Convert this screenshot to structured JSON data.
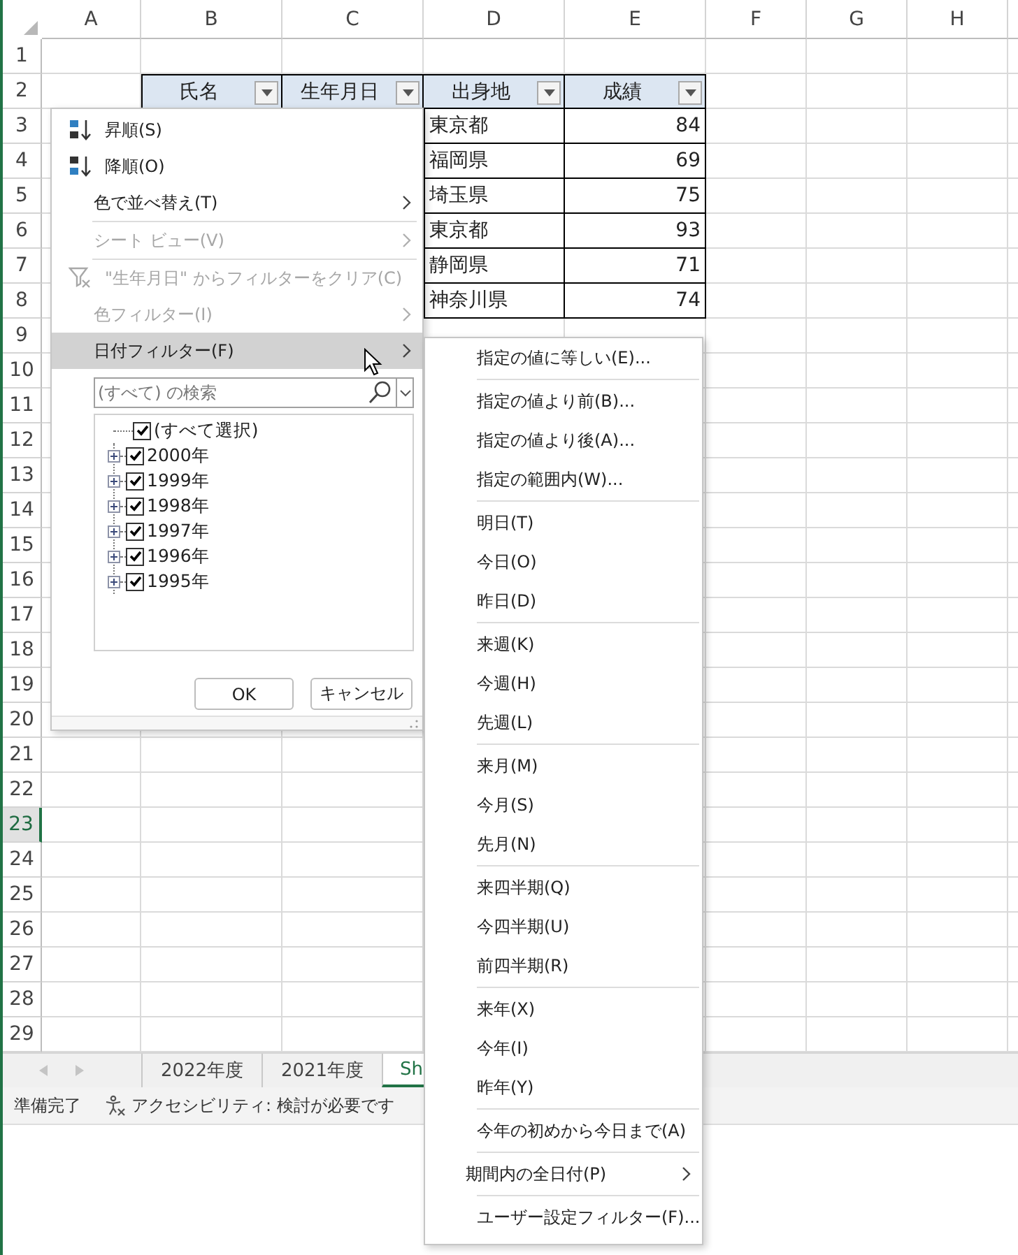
{
  "column_headers": [
    "A",
    "B",
    "C",
    "D",
    "E",
    "F",
    "G",
    "H"
  ],
  "row_headers": [
    {
      "label": "1",
      "selected": false
    },
    {
      "label": "2",
      "selected": false
    },
    {
      "label": "3",
      "selected": false
    },
    {
      "label": "4",
      "selected": false
    },
    {
      "label": "5",
      "selected": false
    },
    {
      "label": "6",
      "selected": false
    },
    {
      "label": "7",
      "selected": false
    },
    {
      "label": "8",
      "selected": false
    },
    {
      "label": "9",
      "selected": false
    },
    {
      "label": "10",
      "selected": false
    },
    {
      "label": "11",
      "selected": false
    },
    {
      "label": "12",
      "selected": false
    },
    {
      "label": "13",
      "selected": false
    },
    {
      "label": "14",
      "selected": false
    },
    {
      "label": "15",
      "selected": false
    },
    {
      "label": "16",
      "selected": false
    },
    {
      "label": "17",
      "selected": false
    },
    {
      "label": "18",
      "selected": false
    },
    {
      "label": "19",
      "selected": false
    },
    {
      "label": "20",
      "selected": false
    },
    {
      "label": "21",
      "selected": false
    },
    {
      "label": "22",
      "selected": false
    },
    {
      "label": "23",
      "selected": true
    },
    {
      "label": "24",
      "selected": false
    },
    {
      "label": "25",
      "selected": false
    },
    {
      "label": "26",
      "selected": false
    },
    {
      "label": "27",
      "selected": false
    },
    {
      "label": "28",
      "selected": false
    },
    {
      "label": "29",
      "selected": false
    }
  ],
  "table": {
    "columns": [
      {
        "label": "氏名"
      },
      {
        "label": "生年月日"
      },
      {
        "label": "出身地"
      },
      {
        "label": "成績"
      }
    ],
    "rows": [
      {
        "birthplace": "東京都",
        "score": "84"
      },
      {
        "birthplace": "福岡県",
        "score": "69"
      },
      {
        "birthplace": "埼玉県",
        "score": "75"
      },
      {
        "birthplace": "東京都",
        "score": "93"
      },
      {
        "birthplace": "静岡県",
        "score": "71"
      },
      {
        "birthplace": "神奈川県",
        "score": "74"
      }
    ]
  },
  "filter_menu": {
    "groups": [
      [
        {
          "label": "昇順(S)",
          "kind": "sort-asc",
          "disabled": false,
          "selected": false
        },
        {
          "label": "降順(O)",
          "kind": "sort-desc",
          "disabled": false,
          "selected": false
        },
        {
          "label": "色で並べ替え(T)",
          "kind": "submenu",
          "disabled": false,
          "selected": false
        }
      ],
      [
        {
          "label": "シート ビュー(V)",
          "kind": "submenu",
          "disabled": true,
          "selected": false
        }
      ],
      [
        {
          "label": "\"生年月日\" からフィルターをクリア(C)",
          "kind": "clear",
          "disabled": true,
          "selected": false
        },
        {
          "label": "色フィルター(I)",
          "kind": "submenu",
          "disabled": true,
          "selected": false
        },
        {
          "label": "日付フィルター(F)",
          "kind": "submenu",
          "disabled": false,
          "selected": true
        }
      ]
    ],
    "search": {
      "placeholder": "(すべて) の検索"
    },
    "tree": {
      "label": "(すべて選択)",
      "checked": true,
      "children": [
        {
          "label": "2000年",
          "checked": true,
          "expanded": false
        },
        {
          "label": "1999年",
          "checked": true,
          "expanded": false
        },
        {
          "label": "1998年",
          "checked": true,
          "expanded": false
        },
        {
          "label": "1997年",
          "checked": true,
          "expanded": false
        },
        {
          "label": "1996年",
          "checked": true,
          "expanded": false
        },
        {
          "label": "1995年",
          "checked": true,
          "expanded": false
        }
      ]
    },
    "buttons": [
      "OK",
      "キャンセル"
    ]
  },
  "date_filter_menu": {
    "groups": [
      [
        {
          "label": "指定の値に等しい(E)...",
          "kind": "command",
          "selected": false
        }
      ],
      [
        {
          "label": "指定の値より前(B)...",
          "kind": "command",
          "selected": false
        },
        {
          "label": "指定の値より後(A)...",
          "kind": "command",
          "selected": false
        },
        {
          "label": "指定の範囲内(W)...",
          "kind": "command",
          "selected": false
        }
      ],
      [
        {
          "label": "明日(T)",
          "kind": "command",
          "selected": false
        },
        {
          "label": "今日(O)",
          "kind": "command",
          "selected": false
        },
        {
          "label": "昨日(D)",
          "kind": "command",
          "selected": false
        }
      ],
      [
        {
          "label": "来週(K)",
          "kind": "command",
          "selected": false
        },
        {
          "label": "今週(H)",
          "kind": "command",
          "selected": false
        },
        {
          "label": "先週(L)",
          "kind": "command",
          "selected": false
        }
      ],
      [
        {
          "label": "来月(M)",
          "kind": "command",
          "selected": false
        },
        {
          "label": "今月(S)",
          "kind": "command",
          "selected": false
        },
        {
          "label": "先月(N)",
          "kind": "command",
          "selected": false
        }
      ],
      [
        {
          "label": "来四半期(Q)",
          "kind": "command",
          "selected": false
        },
        {
          "label": "今四半期(U)",
          "kind": "command",
          "selected": false
        },
        {
          "label": "前四半期(R)",
          "kind": "command",
          "selected": false
        }
      ],
      [
        {
          "label": "来年(X)",
          "kind": "command",
          "selected": false
        },
        {
          "label": "今年(I)",
          "kind": "command",
          "selected": false
        },
        {
          "label": "昨年(Y)",
          "kind": "command",
          "selected": false
        }
      ],
      [
        {
          "label": "今年の初めから今日まで(A)",
          "kind": "command",
          "selected": false
        }
      ],
      [
        {
          "label": "期間内の全日付(P)",
          "kind": "submenu",
          "selected": false
        }
      ],
      [
        {
          "label": "ユーザー設定フィルター(F)...",
          "kind": "command",
          "selected": false
        }
      ]
    ]
  },
  "sheet_tabs": [
    {
      "label": "2022年度",
      "selected": false
    },
    {
      "label": "2021年度",
      "selected": false
    },
    {
      "label": "Sh",
      "selected": true
    }
  ],
  "status_bar": {
    "status": "準備完了",
    "accessibility": "アクセシビリティ: 検討が必要です"
  }
}
